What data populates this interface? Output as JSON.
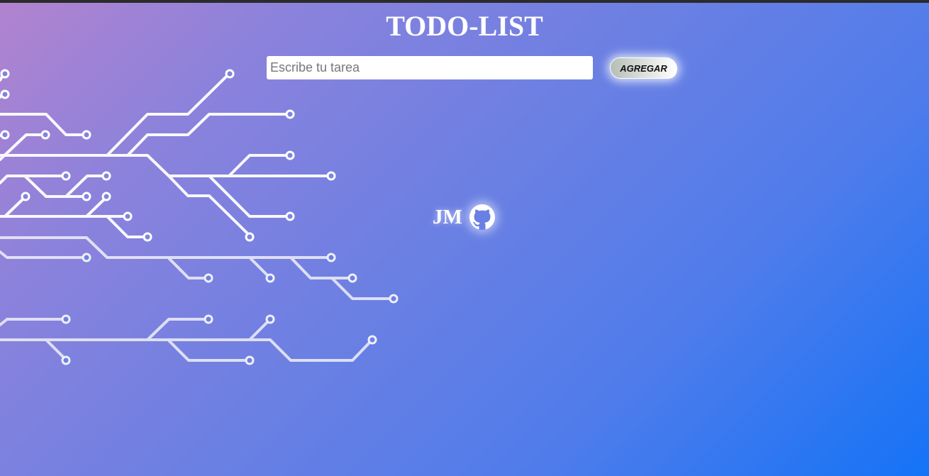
{
  "app": {
    "title": "TODO-LIST"
  },
  "task_form": {
    "input_value": "",
    "input_placeholder": "Escribe tu tarea",
    "add_button_label": "AGREGAR"
  },
  "footer": {
    "initials": "JM",
    "github_icon": "github-icon"
  },
  "colors": {
    "background_start": "#b283cf",
    "background_end": "#1473f6",
    "title_text": "#ffffff",
    "circuit_lines": "#ffffff"
  }
}
